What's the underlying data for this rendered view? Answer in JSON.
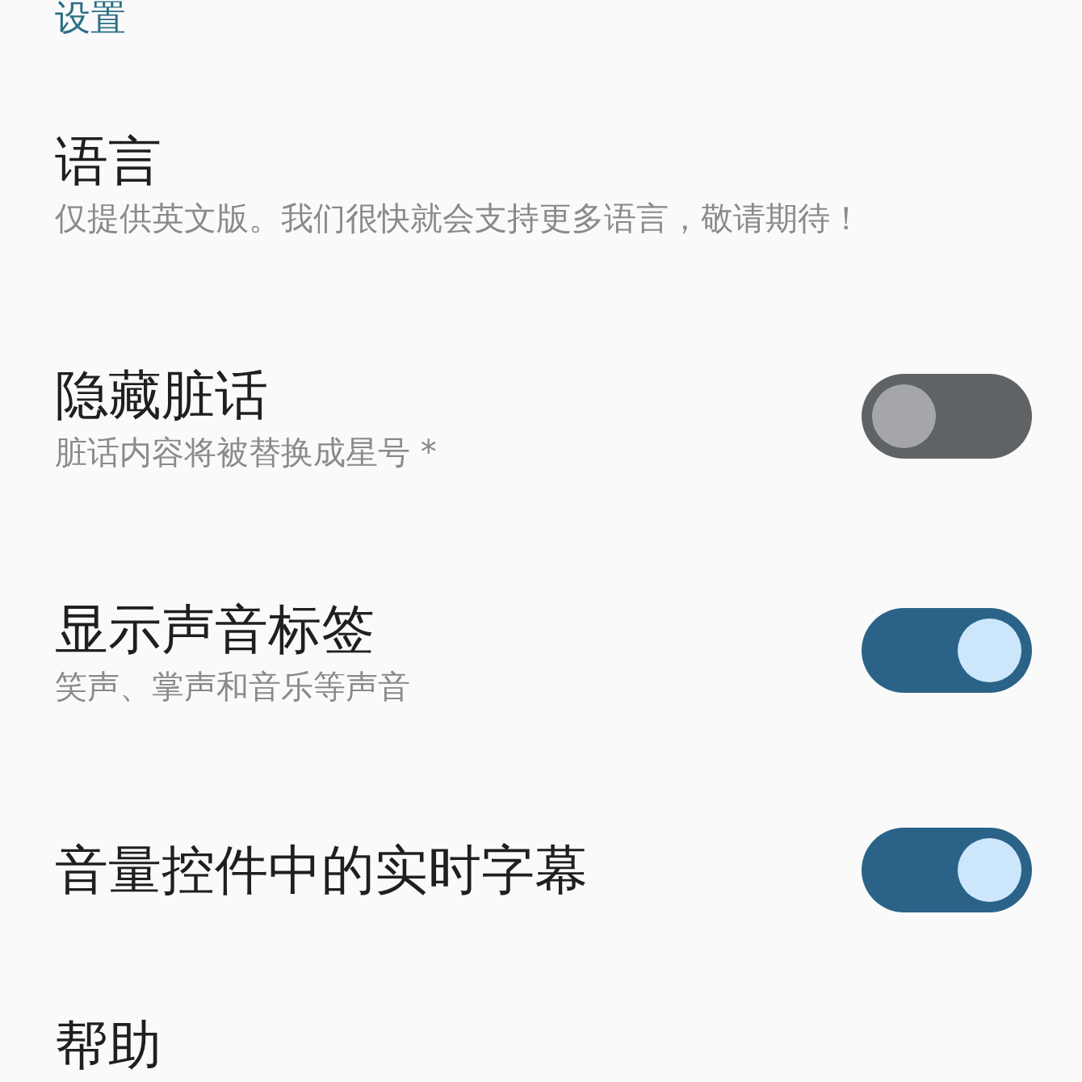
{
  "header": {
    "title": "设置"
  },
  "items": [
    {
      "kind": "text",
      "title": "语言",
      "subtitle": "仅提供英文版。我们很快就会支持更多语言，敬请期待！"
    },
    {
      "kind": "toggle",
      "title": "隐藏脏话",
      "subtitle": "脏话内容将被替换成星号 *",
      "on": false
    },
    {
      "kind": "toggle",
      "title": "显示声音标签",
      "subtitle": "笑声、掌声和音乐等声音",
      "on": true
    },
    {
      "kind": "toggle",
      "title": "音量控件中的实时字幕",
      "on": true
    },
    {
      "kind": "text",
      "title": "帮助"
    }
  ]
}
